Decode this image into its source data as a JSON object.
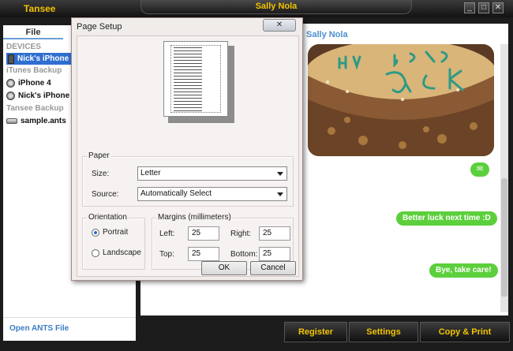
{
  "app": {
    "title": "Tansee",
    "contact_title": "Sally Nola",
    "window_buttons": {
      "minimize": "_",
      "maximize": "□",
      "close": "✕"
    }
  },
  "sidebar": {
    "tab": "File",
    "sections": {
      "devices": "DEVICES",
      "itunes_backup": "iTunes Backup",
      "tansee_backup": "Tansee Backup"
    },
    "items": {
      "selected_device": "Nick's iPhone",
      "backup_1": "iPhone 4",
      "backup_2": "Nick's iPhone",
      "tansee_file": "sample.ants"
    },
    "open_link": "Open ANTS File"
  },
  "conversation": {
    "contact_name": "Sally Nola",
    "messages": [
      {
        "text": "✉"
      },
      {
        "text": "Better luck next time :D"
      },
      {
        "text": "Bye, take care!"
      }
    ]
  },
  "toolbar": {
    "register": "Register",
    "settings": "Settings",
    "copy_print": "Copy & Print"
  },
  "dialog": {
    "title": "Page Setup",
    "close": "✕",
    "paper": {
      "label": "Paper",
      "size_label": "Size:",
      "size_value": "Letter",
      "source_label": "Source:",
      "source_value": "Automatically Select"
    },
    "orientation": {
      "label": "Orientation",
      "portrait": "Portrait",
      "landscape": "Landscape",
      "selected": "Portrait"
    },
    "margins": {
      "label": "Margins (millimeters)",
      "left_label": "Left:",
      "left": "25",
      "right_label": "Right:",
      "right": "25",
      "top_label": "Top:",
      "top": "25",
      "bottom_label": "Bottom:",
      "bottom": "25"
    },
    "ok": "OK",
    "cancel": "Cancel"
  },
  "colors": {
    "accent_yellow": "#f2c400",
    "bubble_green": "#5ccf3c",
    "link_blue": "#3b7dc4",
    "selection_blue": "#2f6fd0"
  }
}
